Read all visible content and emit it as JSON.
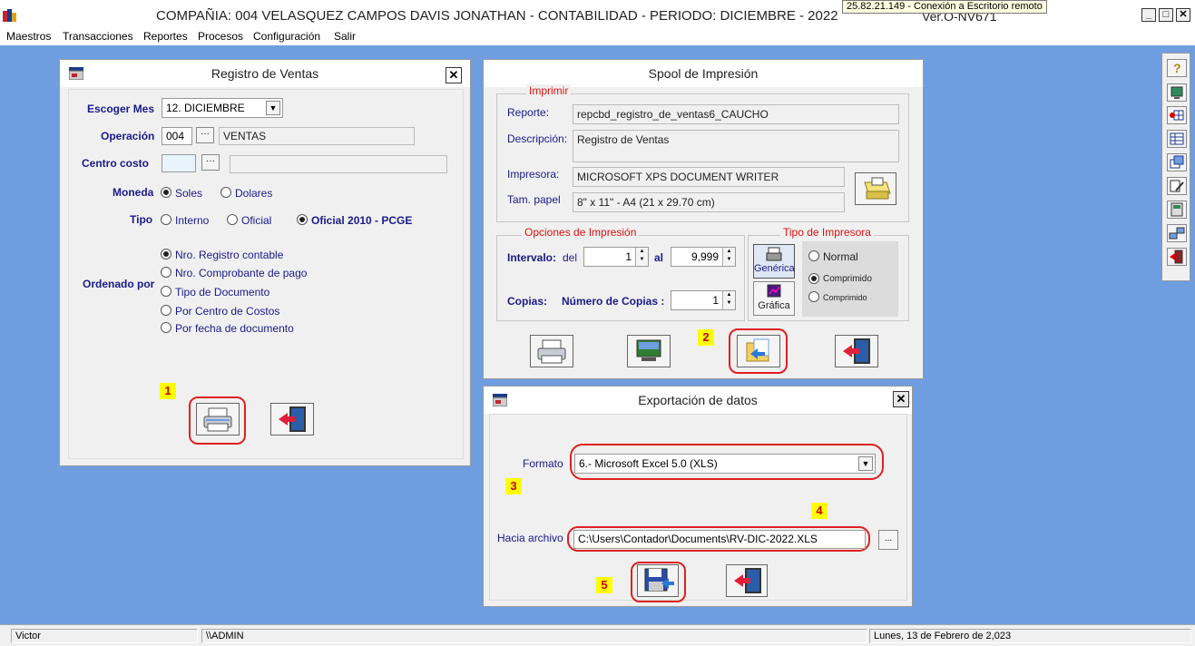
{
  "app": {
    "title": "COMPAÑIA:  004 VELASQUEZ CAMPOS DAVIS JONATHAN   -   CONTABILIDAD   -    PERIODO: DICIEMBRE - 2022",
    "version": "Ver.O-NV671",
    "rdp_tooltip": "25.82.21.149 - Conexión a Escritorio remoto"
  },
  "menu": [
    "Maestros",
    "Transacciones",
    "Reportes",
    "Procesos",
    "Configuración",
    "Salir"
  ],
  "registro": {
    "title": "Registro de Ventas",
    "mes_label": "Escoger Mes",
    "mes_value": "12. DICIEMBRE",
    "operacion_label": "Operación",
    "operacion_code": "004",
    "operacion_name": "VENTAS",
    "centro_label": "Centro costo",
    "centro_code": "",
    "centro_name": "",
    "moneda_label": "Moneda",
    "moneda_opts": [
      "Soles",
      "Dolares"
    ],
    "tipo_label": "Tipo",
    "tipo_opts": [
      "Interno",
      "Oficial",
      "Oficial 2010 - PCGE"
    ],
    "orden_label": "Ordenado por",
    "orden_opts": [
      "Nro. Registro contable",
      "Nro. Comprobante de pago",
      "Tipo de Documento",
      "Por Centro de Costos",
      "Por fecha de documento"
    ],
    "marker": "1"
  },
  "spool": {
    "title": "Spool de Impresión",
    "imprimir_title": "Imprimir",
    "reporte_label": "Reporte:",
    "reporte_value": "repcbd_registro_de_ventas6_CAUCHO",
    "desc_label": "Descripción:",
    "desc_value": "Registro de Ventas",
    "impresora_label": "Impresora:",
    "impresora_value": "MICROSOFT XPS DOCUMENT WRITER",
    "papel_label": "Tam. papel",
    "papel_value": "8\" x 11\"  - A4 (21 x 29.70 cm)",
    "opciones_title": "Opciones de Impresión",
    "intervalo_label": "Intervalo:",
    "del_label": "del",
    "del_value": "1",
    "al_label": "al",
    "al_value": "9,999",
    "copias_label": "Copias:",
    "num_copias_label": "Número de Copias :",
    "copias_value": "1",
    "tipo_impresora_title": "Tipo de Impresora",
    "generica_label": "Genérica",
    "grafica_label": "Gráfica",
    "normal_label": "Normal",
    "comprimido_label": "Comprimido",
    "comprimido2_label": "Comprimido",
    "marker": "2"
  },
  "export": {
    "title": "Exportación de datos",
    "formato_label": "Formato",
    "formato_value": "6.- Microsoft Excel 5.0 (XLS)",
    "archivo_label": "Hacia archivo",
    "archivo_value": "C:\\Users\\Contador\\Documents\\RV-DIC-2022.XLS",
    "markers": [
      "3",
      "4",
      "5"
    ]
  },
  "status": {
    "user": "Victor",
    "path": "\\\\ADMIN",
    "date": "Lunes, 13 de Febrero de 2,023"
  }
}
